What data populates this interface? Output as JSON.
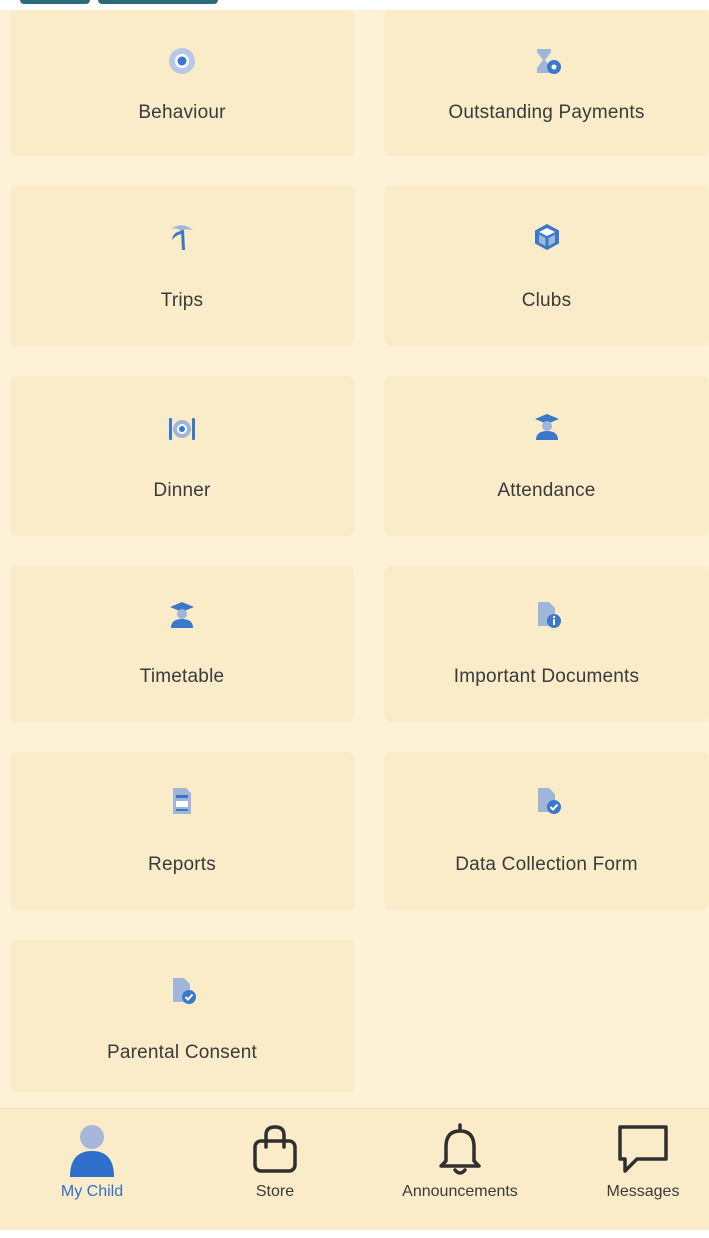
{
  "tiles": {
    "behaviour": "Behaviour",
    "outstanding_payments": "Outstanding Payments",
    "trips": "Trips",
    "clubs": "Clubs",
    "dinner": "Dinner",
    "attendance": "Attendance",
    "timetable": "Timetable",
    "important_documents": "Important Documents",
    "reports": "Reports",
    "data_collection_form": "Data Collection Form",
    "parental_consent": "Parental Consent"
  },
  "tabbar": {
    "my_child": "My Child",
    "store": "Store",
    "announcements": "Announcements",
    "messages": "Messages",
    "active_tab": "My Child"
  },
  "icons": {
    "behaviour": "eye-icon",
    "outstanding_payments": "hourglass-icon",
    "trips": "palm-tree-icon",
    "clubs": "cube-icon",
    "dinner": "cutlery-plate-icon",
    "attendance": "graduate-icon",
    "timetable": "graduate-icon",
    "important_documents": "document-info-icon",
    "reports": "report-icon",
    "data_collection_form": "document-check-icon",
    "parental_consent": "document-check-icon"
  },
  "colors": {
    "background": "#fdf1d6",
    "tile": "#fbecc9",
    "icon_blue": "#3b78c9",
    "icon_light": "#9fb6da",
    "active_tab": "#2e6fc9",
    "text": "#3a3a3a"
  }
}
